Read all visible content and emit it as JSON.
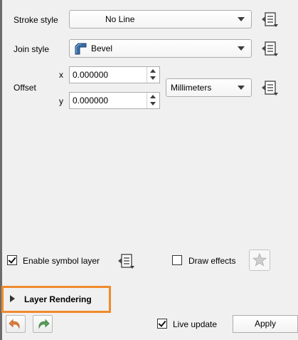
{
  "stroke_style": {
    "label": "Stroke style",
    "value": "No Line"
  },
  "join_style": {
    "label": "Join style",
    "value": "Bevel"
  },
  "offset": {
    "label": "Offset",
    "x_label": "x",
    "x_value": "0.000000",
    "y_label": "y",
    "y_value": "0.000000",
    "unit": "Millimeters"
  },
  "enable_symbol_layer": {
    "label": "Enable symbol layer",
    "checked": true
  },
  "draw_effects": {
    "label": "Draw effects",
    "checked": false
  },
  "layer_rendering": {
    "label": "Layer Rendering",
    "highlight_color": "#f08a2c"
  },
  "live_update": {
    "label": "Live update",
    "checked": true
  },
  "apply_label": "Apply",
  "icons": {
    "data_defined": "data-defined-override-icon",
    "join": "bevel-join-icon",
    "undo": "undo-icon",
    "redo": "redo-icon",
    "effects": "star-icon",
    "expand": "triangle-right-icon"
  }
}
